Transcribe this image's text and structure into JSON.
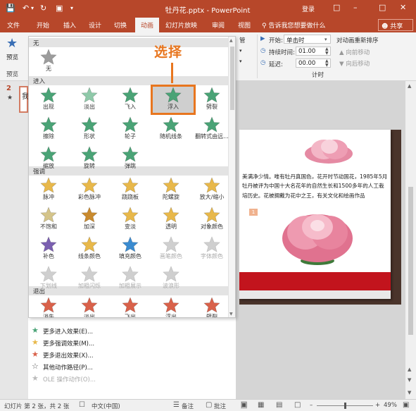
{
  "window": {
    "title": "牡丹花.pptx - PowerPoint",
    "login": "登录",
    "quick_access": [
      "save-icon",
      "undo-icon",
      "redo-icon",
      "start-slideshow-icon",
      "customize-icon"
    ]
  },
  "ribbon_tabs": {
    "items": [
      "文件",
      "开始",
      "插入",
      "设计",
      "切换",
      "动画",
      "幻灯片放映",
      "审阅",
      "视图"
    ],
    "active": "动画",
    "tellme": "告诉我您想要做什么",
    "share": "共享"
  },
  "ribbon": {
    "preview_label": "预览",
    "preview_group": "预览",
    "trigger_fragment": "管",
    "start_label": "开始:",
    "start_value": "单击时",
    "duration_label": "持续时间:",
    "duration_value": "01.00",
    "delay_label": "延迟:",
    "delay_value": "00.00",
    "reorder_title": "对动画重新排序",
    "move_earlier": "向前移动",
    "move_later": "向后移动",
    "timing_group": "计时"
  },
  "thumbnails": {
    "slide_number": "2",
    "star": "★",
    "text": "我"
  },
  "gallery": {
    "sections": {
      "none": "无",
      "entrance": "进入",
      "emphasis": "强调",
      "exit": "退出"
    },
    "none_items": [
      {
        "label": "无",
        "color": "#9c9c9c"
      }
    ],
    "entrance_items": [
      {
        "label": "出现",
        "color": "#4aa376"
      },
      {
        "label": "淡出",
        "color": "#8fc9a9"
      },
      {
        "label": "飞入",
        "color": "#4aa376"
      },
      {
        "label": "浮入",
        "color": "#4aa376"
      },
      {
        "label": "劈裂",
        "color": "#4aa376"
      },
      {
        "label": "擦除",
        "color": "#4aa376"
      },
      {
        "label": "形状",
        "color": "#4aa376"
      },
      {
        "label": "轮子",
        "color": "#4aa376"
      },
      {
        "label": "随机线条",
        "color": "#4aa376"
      },
      {
        "label": "翻转式由远...",
        "color": "#4aa376"
      },
      {
        "label": "缩放",
        "color": "#4aa376"
      },
      {
        "label": "旋转",
        "color": "#4aa376"
      },
      {
        "label": "弹跳",
        "color": "#4aa376"
      }
    ],
    "emphasis_items": [
      {
        "label": "脉冲",
        "color": "#e8b84a"
      },
      {
        "label": "彩色脉冲",
        "color": "#e8b84a"
      },
      {
        "label": "跷跷板",
        "color": "#e8b84a"
      },
      {
        "label": "陀螺旋",
        "color": "#e8b84a"
      },
      {
        "label": "放大/缩小",
        "color": "#e8b84a"
      },
      {
        "label": "不饱和",
        "color": "#d4c48a"
      },
      {
        "label": "加深",
        "color": "#c98a2e"
      },
      {
        "label": "变淡",
        "color": "#e8b84a"
      },
      {
        "label": "透明",
        "color": "#e8b84a"
      },
      {
        "label": "对象颜色",
        "color": "#e8b84a"
      },
      {
        "label": "补色",
        "color": "#7a5fb0"
      },
      {
        "label": "线条颜色",
        "color": "#e8b84a"
      },
      {
        "label": "填充颜色",
        "color": "#3a8bd0"
      },
      {
        "label": "画笔颜色",
        "color": "#cfcfcf"
      },
      {
        "label": "字体颜色",
        "color": "#cfcfcf"
      },
      {
        "label": "下划线",
        "color": "#cfcfcf"
      },
      {
        "label": "加粗闪烁",
        "color": "#cfcfcf"
      },
      {
        "label": "加粗展示",
        "color": "#cfcfcf"
      },
      {
        "label": "波浪形",
        "color": "#cfcfcf"
      }
    ],
    "emphasis_disabled_from": 13,
    "exit_items": [
      {
        "label": "消失",
        "color": "#d9614a"
      },
      {
        "label": "淡出",
        "color": "#d9614a"
      },
      {
        "label": "飞出",
        "color": "#d9614a"
      },
      {
        "label": "浮出",
        "color": "#d9614a"
      },
      {
        "label": "劈裂",
        "color": "#d9614a"
      }
    ],
    "selected_label": "浮入",
    "callout": "选择",
    "menu": [
      {
        "label": "更多进入效果(E)...",
        "icon": "entrance-star-icon",
        "color": "#4aa376"
      },
      {
        "label": "更多强调效果(M)...",
        "icon": "emphasis-star-icon",
        "color": "#e8b84a"
      },
      {
        "label": "更多退出效果(X)...",
        "icon": "exit-star-icon",
        "color": "#d9614a"
      },
      {
        "label": "其他动作路径(P)...",
        "icon": "motion-path-star-icon",
        "color": "#555555"
      },
      {
        "label": "OLE 操作动作(O)...",
        "icon": "ole-action-icon",
        "color": "#bbbbbb"
      }
    ]
  },
  "slide": {
    "body": "美满净少情。唯有牡丹真国色，花开时节动国花，1985年5月牡丹被评为中国十大名花年的自然生长和1500多年的人工栽培历史。花被拥戴为花中之王，有关文化和绘画作品",
    "tag": "1",
    "band_color": "#c2141d"
  },
  "status": {
    "slide_info": "幻灯片 第 2 张，共 2 张",
    "language": "中文(中国)",
    "notes": "备注",
    "comments": "批注",
    "zoom": "49%"
  },
  "colors": {
    "accent": "#b7472a",
    "callout": "#e8761f"
  }
}
